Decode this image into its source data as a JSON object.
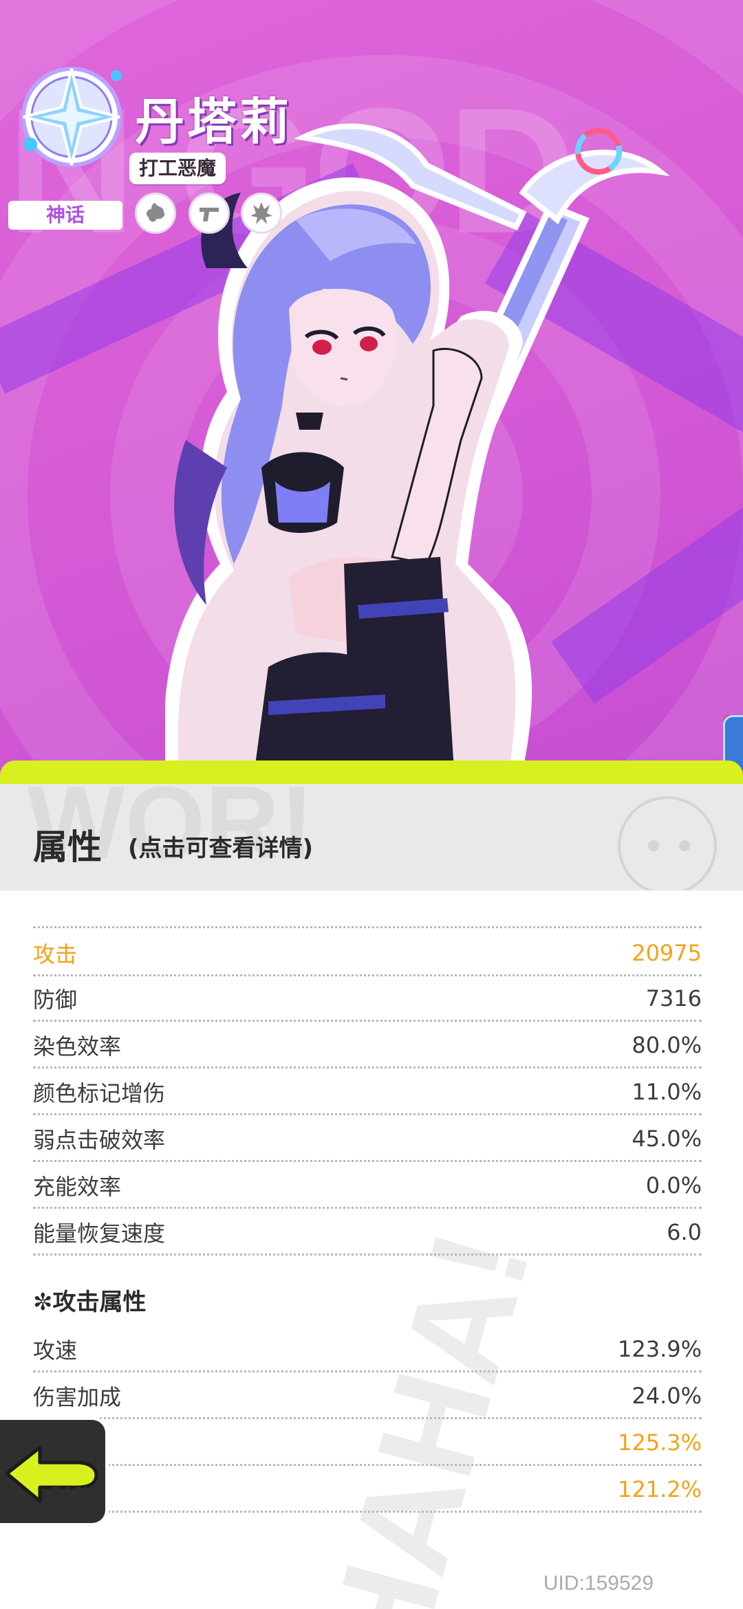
{
  "character": {
    "name": "丹塔莉",
    "title": "打工恶魔",
    "rarity": "神话",
    "background_word": "N GOD"
  },
  "skills": [
    {
      "icon": "paint-splash-icon"
    },
    {
      "icon": "pistol-icon"
    },
    {
      "icon": "flame-burst-icon"
    }
  ],
  "panel": {
    "title": "属性",
    "hint": "(点击可查看详情)"
  },
  "stats": [
    {
      "label": "攻击",
      "value": "20975",
      "highlight": true
    },
    {
      "label": "防御",
      "value": "7316",
      "highlight": false
    },
    {
      "label": "染色效率",
      "value": "80.0%",
      "highlight": false
    },
    {
      "label": "颜色标记增伤",
      "value": "11.0%",
      "highlight": false
    },
    {
      "label": "弱点击破效率",
      "value": "45.0%",
      "highlight": false
    },
    {
      "label": "充能效率",
      "value": "0.0%",
      "highlight": false
    },
    {
      "label": "能量恢复速度",
      "value": "6.0",
      "highlight": false
    }
  ],
  "attack_section": {
    "title": "✼攻击属性",
    "stats": [
      {
        "label": "攻速",
        "value": "123.9%",
        "highlight": false
      },
      {
        "label": "伤害加成",
        "value": "24.0%",
        "highlight": false
      },
      {
        "label": "",
        "value": "125.3%",
        "highlight": true
      },
      {
        "label": "害",
        "value": "121.2%",
        "highlight": true
      }
    ]
  },
  "back_button": {
    "label": "BACK",
    "icon": "back-arrow-icon"
  },
  "uid": "UID:159529",
  "colors": {
    "background": "#d95fd6",
    "accent_yellow": "#d8f01e",
    "highlight_orange": "#f3a21a",
    "rarity_purple": "#b04fe4"
  }
}
